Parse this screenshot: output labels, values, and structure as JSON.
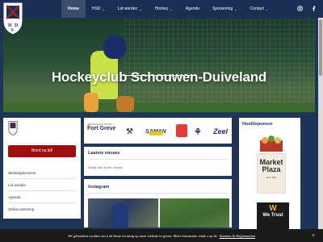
{
  "nav": {
    "items": [
      {
        "label": "Home",
        "active": true
      },
      {
        "label": "HSD",
        "dropdown": true
      },
      {
        "label": "Lid worden",
        "dropdown": true
      },
      {
        "label": "Hockey",
        "dropdown": true
      },
      {
        "label": "Agenda"
      },
      {
        "label": "Sponsoring",
        "dropdown": true
      },
      {
        "label": "Contact",
        "dropdown": true
      }
    ],
    "caret": "⌄",
    "social": [
      "instagram-icon",
      "facebook-icon"
    ]
  },
  "logo": {
    "letters": [
      "H",
      "S",
      "D"
    ]
  },
  "hero": {
    "title": "Hockeyclub Schouwen-Duiveland"
  },
  "sidebar": {
    "join_label": "Word nu lid!",
    "links": [
      "Wedstrijdschema",
      "Lid worden",
      "Agenda",
      "Online webshop"
    ]
  },
  "sponsors_strip": {
    "fort_small": "RESTAURANT HOTEL",
    "fort": "Fort Greve",
    "hammer": "⚒",
    "saman": "SAMAN",
    "swirl": "⚘",
    "zeel": "Zeel"
  },
  "news": {
    "title": "Laatste nieuws",
    "more": "Bekijk hier al het nieuws"
  },
  "instagram": {
    "title": "Instagram"
  },
  "main_sponsor": {
    "title": "Hoofdsponsor",
    "mp_line1": "Market",
    "mp_line2": "Plaza",
    "mp_line3": "Delh Bak",
    "wt_icon": "W",
    "wt_line1": "We Trust"
  },
  "cookie": {
    "text": "We gebruiken cookies om u de beste ervaring op onze website te geven. Meer informatie vindt u op de",
    "link": "Statuten & Reglementen",
    "close": "×"
  },
  "colors": {
    "nav": "#1b2f55",
    "accent": "#9b0f0f",
    "cookie": "#1a1a1a"
  }
}
